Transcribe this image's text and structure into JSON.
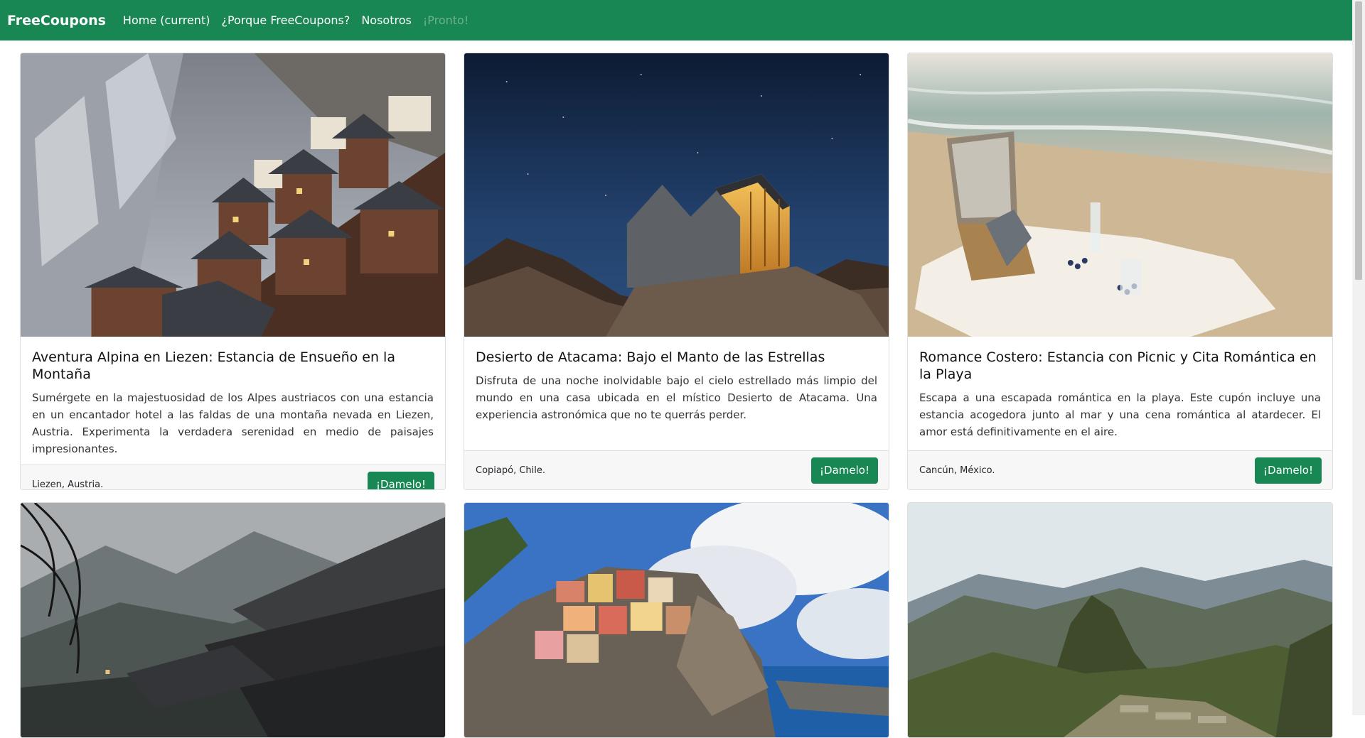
{
  "navbar": {
    "brand": "FreeCoupons",
    "links": [
      {
        "label": "Home (current)"
      },
      {
        "label": "¿Porque FreeCoupons?"
      },
      {
        "label": "Nosotros"
      },
      {
        "label": "¡Pronto!"
      }
    ]
  },
  "cards": [
    {
      "title": "Aventura Alpina en Liezen: Estancia de Ensueño en la Montaña",
      "text": "Sumérgete en la majestuosidad de los Alpes austriacos con una estancia en un encantador hotel a las faldas de una montaña nevada en Liezen, Austria. Experimenta la verdadera serenidad en medio de paisajes impresionantes.",
      "location": "Liezen, Austria.",
      "button": "¡Damelo!"
    },
    {
      "title": "Desierto de Atacama: Bajo el Manto de las Estrellas",
      "text": "Disfruta de una noche inolvidable bajo el cielo estrellado más limpio del mundo en una casa ubicada en el místico Desierto de Atacama. Una experiencia astronómica que no te querrás perder.",
      "location": "Copiapó, Chile.",
      "button": "¡Damelo!"
    },
    {
      "title": "Romance Costero: Estancia con Picnic y Cita Romántica en la Playa",
      "text": "Escapa a una escapada romántica en la playa. Este cupón incluye una estancia acogedora junto al mar y una cena romántica al atardecer. El amor está definitivamente en el aire.",
      "location": "Cancún, México.",
      "button": "¡Damelo!"
    }
  ]
}
